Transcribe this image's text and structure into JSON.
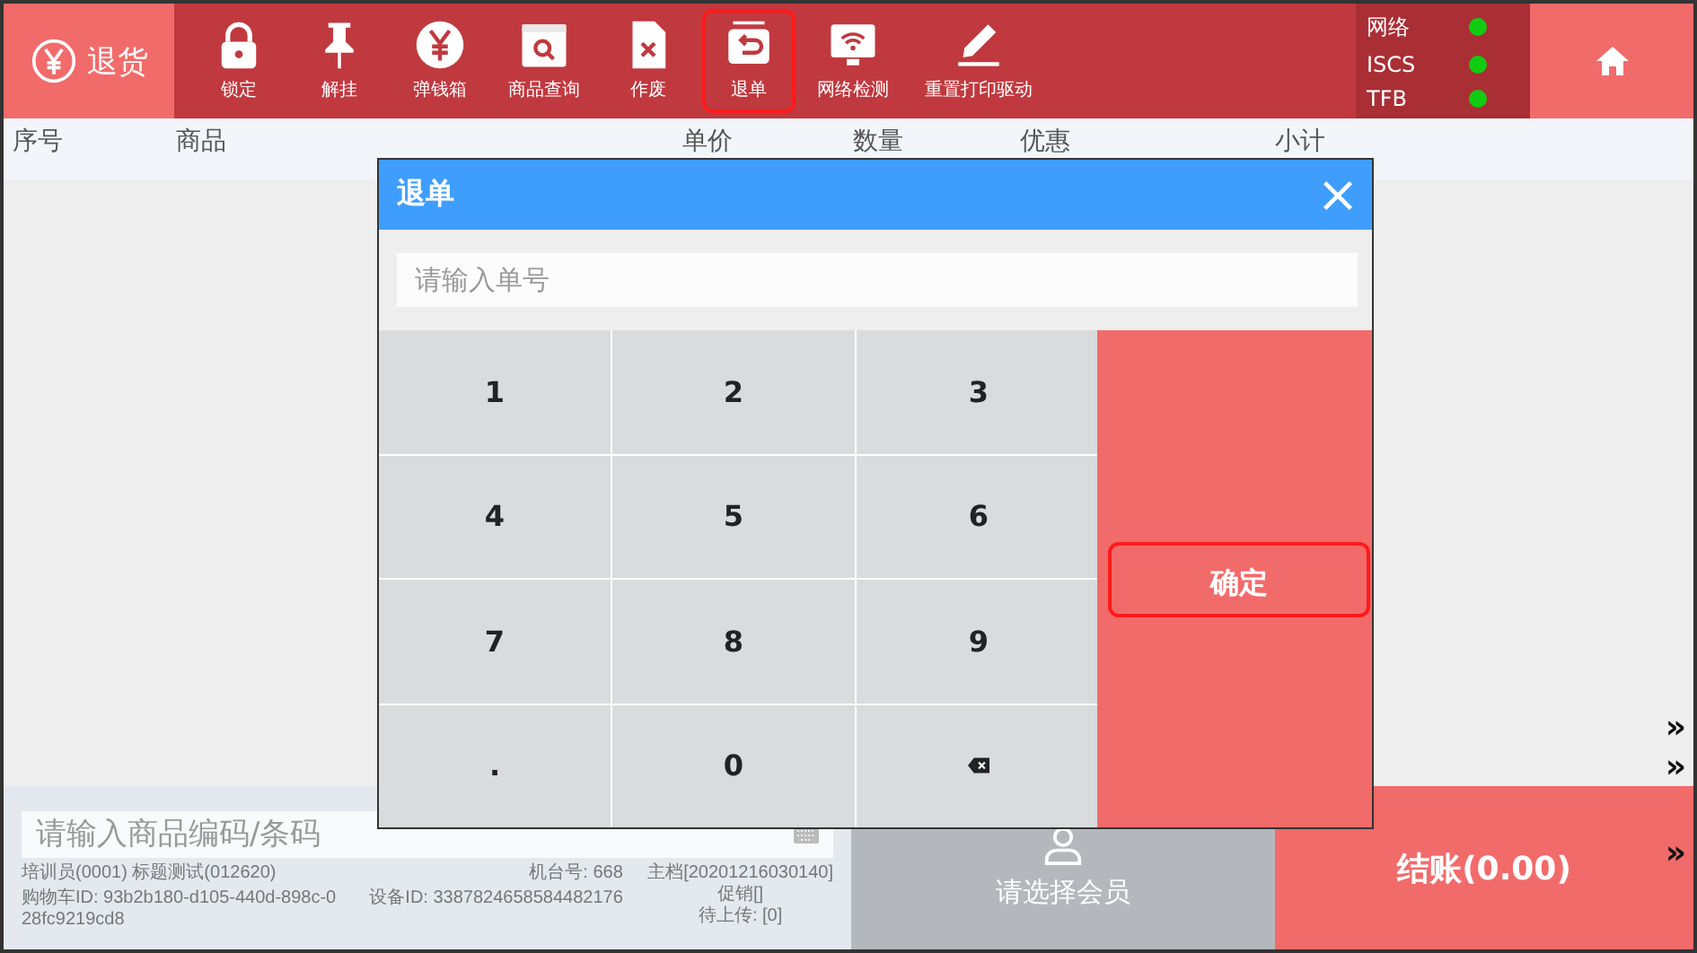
{
  "mode": {
    "label": "退货"
  },
  "toolbar": [
    {
      "kind": "lock",
      "label": "锁定",
      "highlighted": false
    },
    {
      "kind": "pin",
      "label": "解挂",
      "highlighted": false
    },
    {
      "kind": "yen",
      "label": "弹钱箱",
      "highlighted": false
    },
    {
      "kind": "search",
      "label": "商品查询",
      "highlighted": false
    },
    {
      "kind": "void",
      "label": "作废",
      "highlighted": false
    },
    {
      "kind": "return",
      "label": "退单",
      "highlighted": true
    },
    {
      "kind": "wifi",
      "label": "网络检测",
      "highlighted": false
    },
    {
      "kind": "pen",
      "label": "重置打印驱动",
      "highlighted": false
    }
  ],
  "status": [
    {
      "label": "网络",
      "color": "#11cc11"
    },
    {
      "label": "ISCS",
      "color": "#11cc11"
    },
    {
      "label": "TFB",
      "color": "#11cc11"
    }
  ],
  "table": {
    "columns": [
      "序号",
      "商品",
      "单价",
      "数量",
      "优惠",
      "小计"
    ]
  },
  "side_arrows": [
    "»",
    "»"
  ],
  "dialog": {
    "title": "退单",
    "placeholder": "请输入单号",
    "keys": [
      {
        "kind": "text",
        "label": "1"
      },
      {
        "kind": "text",
        "label": "2"
      },
      {
        "kind": "text",
        "label": "3"
      },
      {
        "kind": "text",
        "label": "4"
      },
      {
        "kind": "text",
        "label": "5"
      },
      {
        "kind": "text",
        "label": "6"
      },
      {
        "kind": "text",
        "label": "7"
      },
      {
        "kind": "text",
        "label": "8"
      },
      {
        "kind": "text",
        "label": "9"
      },
      {
        "kind": "text",
        "label": "."
      },
      {
        "kind": "text",
        "label": "0"
      },
      {
        "kind": "backspace"
      }
    ],
    "confirm": {
      "label": "确定",
      "highlighted": true
    }
  },
  "bottom": {
    "placeholder": "请输入商品编码/条码",
    "cashier": "培训员(0001) 标题测试(012620)",
    "cart_id": "购物车ID: 93b2b180-d105-440d-898c-028fc9219cd8",
    "machine": "机台号: 668",
    "device_id": "设备ID: 3387824658584482176",
    "master": "主档[20201216030140]",
    "promo": "促销[]",
    "pending": "待上传: [0]",
    "member": "请选择会员",
    "checkout": "结账(0.00)",
    "checkout_arrow": "»"
  }
}
